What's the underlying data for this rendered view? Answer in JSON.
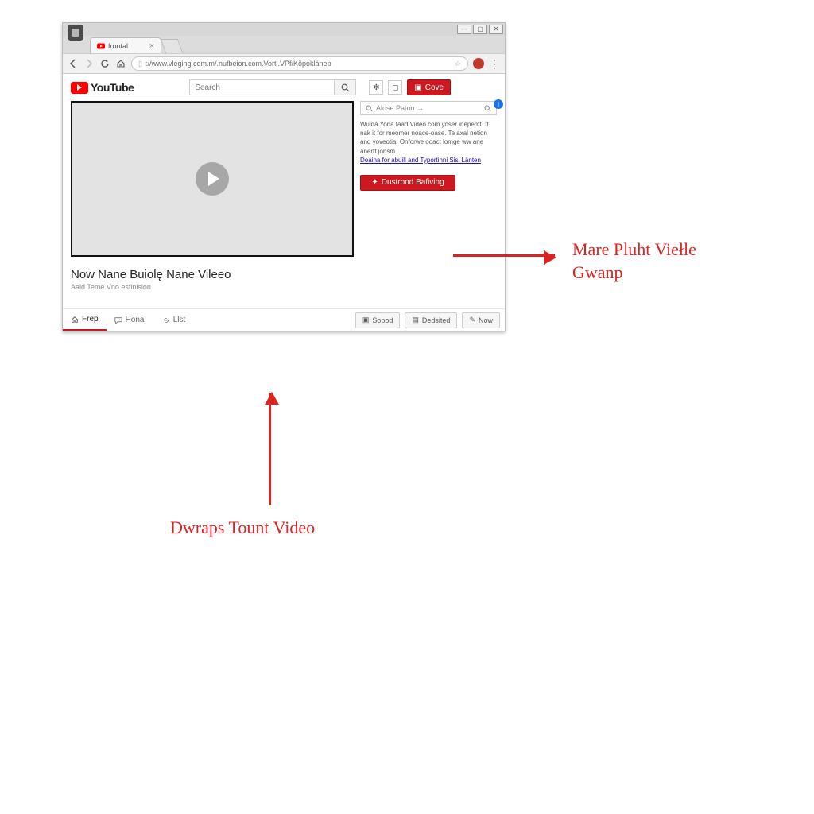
{
  "browser": {
    "tab_label": "frontal",
    "url": "://www.vleging.com.m/.nufbeion.com.Vortl.VPf/Köpoklänep",
    "window_buttons": {
      "min": "—",
      "max": "▢",
      "close": "✕"
    }
  },
  "youtube": {
    "wordmark": "YouTube",
    "search_placeholder": "Search",
    "cove_label": "Cove",
    "side_search_placeholder": "Alose Paton →",
    "side_description": "Wulda Yona faad Video com yoser inepemt. It nak it for meomer noace-oase. Te axal netion and yoveotia. Onforwe ooact lomge ww ane anertf jonsm.",
    "side_link": "Doaina for abuill and Typortinni Sisl Länten",
    "side_button": "Dustrond Bafiving",
    "video_title": "Now Nane Buiolę Nane Vileeo",
    "video_subtitle": "Aald Teme Vno esfinision",
    "tabs": {
      "t1": "Frep",
      "t2": "Honal",
      "t3": "Llst"
    },
    "right_buttons": {
      "b1": "Sopod",
      "b2": "Dedsited",
      "b3": "Now"
    }
  },
  "annotations": {
    "right_line1": "Mare Pluht Viełle",
    "right_line2": "Gwanp",
    "bottom": "Dwraps Tount Video"
  }
}
